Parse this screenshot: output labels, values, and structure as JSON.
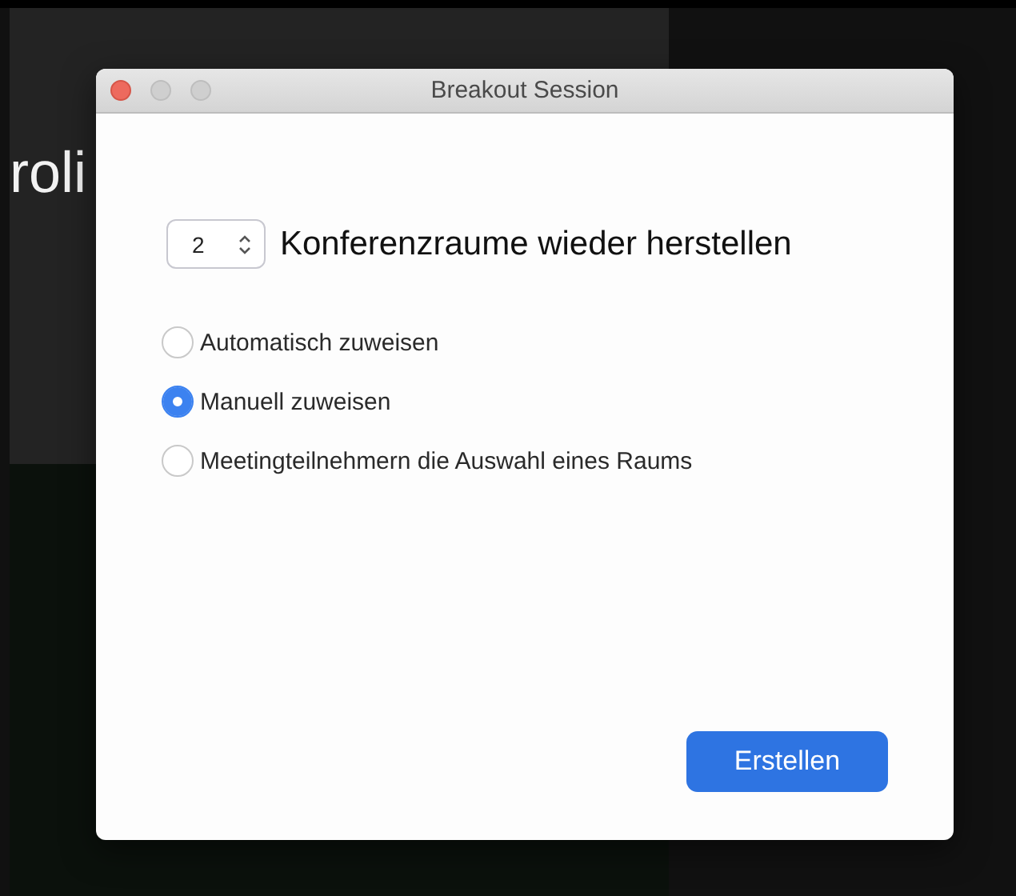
{
  "background": {
    "participant_name": "roli"
  },
  "window": {
    "title": "Breakout Session"
  },
  "room_count": {
    "value": "2",
    "label": "Konferenzraume wieder herstellen"
  },
  "assignment_options": [
    {
      "label": "Automatisch zuweisen",
      "selected": false
    },
    {
      "label": "Manuell zuweisen",
      "selected": true
    },
    {
      "label": "Meetingteilnehmern die Auswahl eines Raums",
      "selected": false
    }
  ],
  "buttons": [
    {
      "label": "Erstellen"
    }
  ]
}
